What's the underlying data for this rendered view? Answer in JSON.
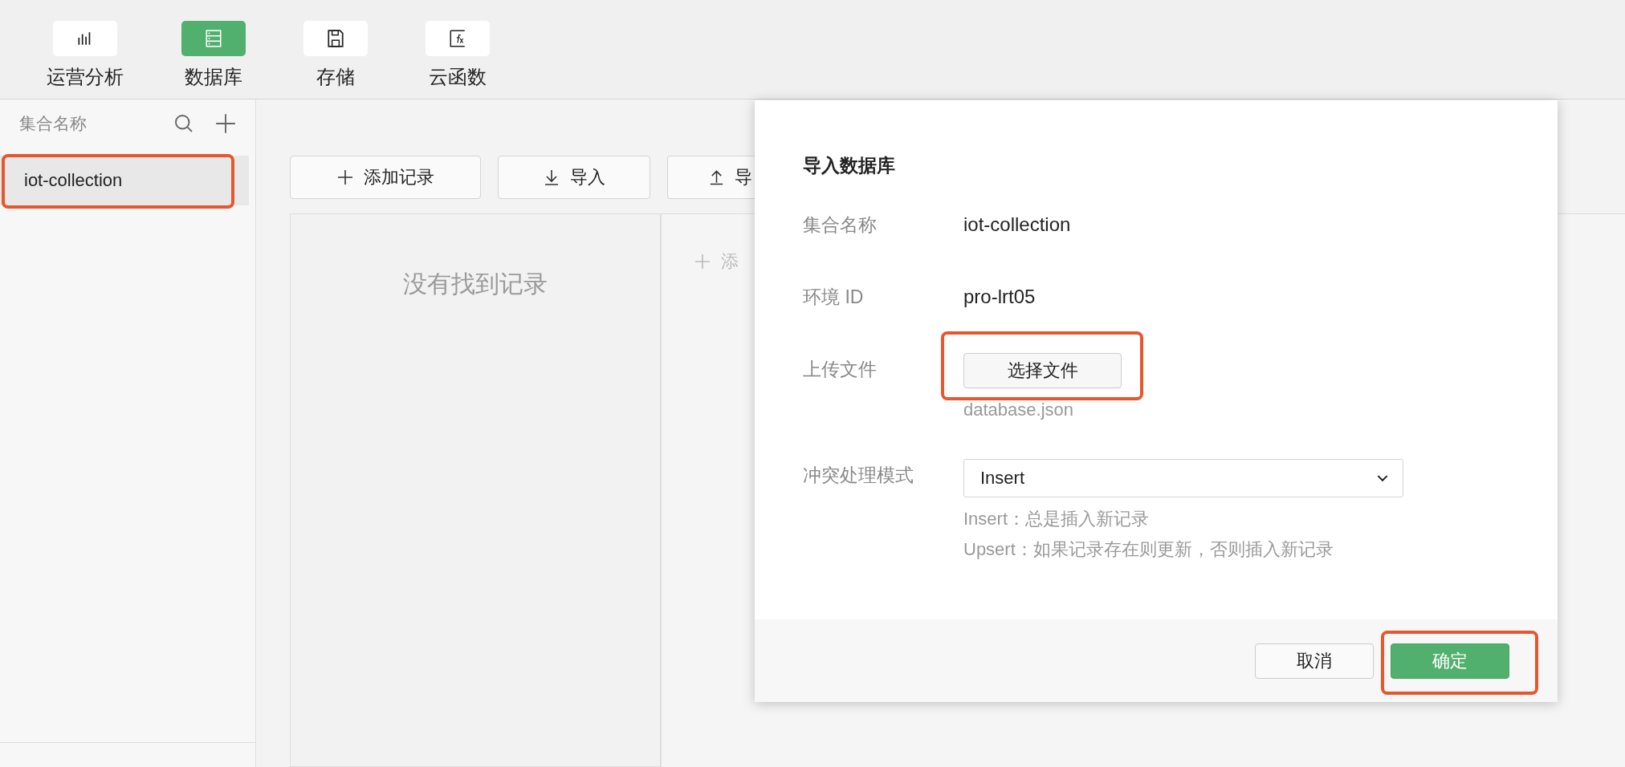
{
  "toolbar": {
    "tabs": [
      {
        "label": "运营分析",
        "selected": false
      },
      {
        "label": "数据库",
        "selected": true
      },
      {
        "label": "存储",
        "selected": false
      },
      {
        "label": "云函数",
        "selected": false
      }
    ]
  },
  "sidebar": {
    "header": "集合名称",
    "items": [
      {
        "label": "iot-collection",
        "selected": true,
        "highlighted": true
      }
    ]
  },
  "main": {
    "buttons": [
      {
        "label": "添加记录"
      },
      {
        "label": "导入"
      },
      {
        "label": "导"
      }
    ],
    "empty_text": "没有找到记录",
    "add_field": "添"
  },
  "dialog": {
    "title": "导入数据库",
    "rows": [
      {
        "kind": "text",
        "label": "集合名称",
        "value": "iot-collection"
      },
      {
        "kind": "text",
        "label": "环境 ID",
        "value": "pro-lrt05"
      },
      {
        "kind": "file",
        "label": "上传文件",
        "button": "选择文件",
        "file": "database.json",
        "highlighted": true
      },
      {
        "kind": "select",
        "label": "冲突处理模式",
        "value": "Insert",
        "hints": [
          "Insert：总是插入新记录",
          "Upsert：如果记录存在则更新，否则插入新记录"
        ]
      }
    ],
    "buttons": [
      {
        "label": "取消",
        "primary": false,
        "highlighted": false
      },
      {
        "label": "确定",
        "primary": true,
        "highlighted": true
      }
    ]
  }
}
